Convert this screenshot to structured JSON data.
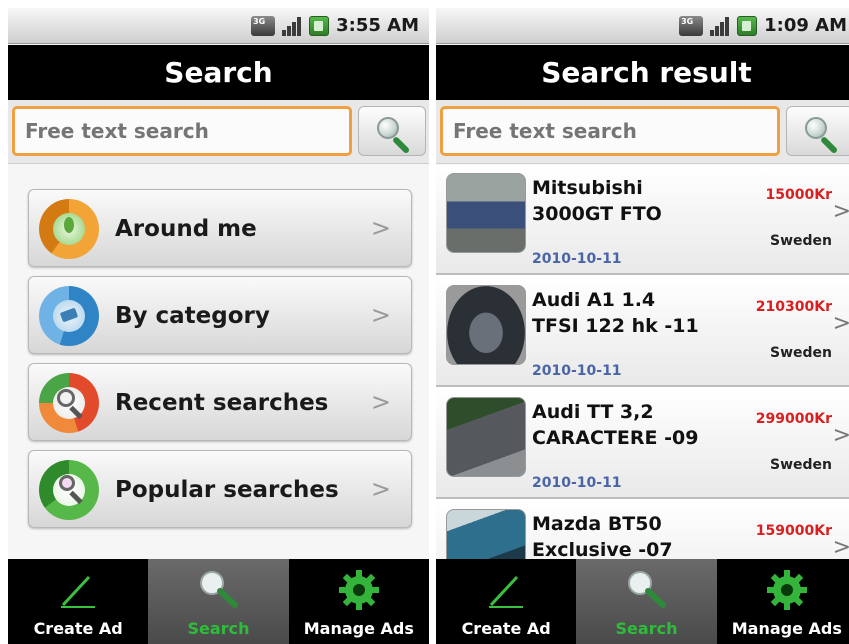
{
  "left_screen": {
    "status": {
      "time": "3:55 AM",
      "network": "3G"
    },
    "title": "Search",
    "search": {
      "placeholder": "Free text search"
    },
    "menu": [
      {
        "label": "Around me",
        "icon": "location-icon"
      },
      {
        "label": "By category",
        "icon": "category-icon"
      },
      {
        "label": "Recent searches",
        "icon": "recent-search-icon"
      },
      {
        "label": "Popular searches",
        "icon": "popular-search-icon"
      }
    ],
    "chevron": ">"
  },
  "right_screen": {
    "status": {
      "time": "1:09 AM",
      "network": "3G"
    },
    "title": "Search result",
    "search": {
      "placeholder": "Free text search"
    },
    "results": [
      {
        "title": "Mitsubishi 3000GT FTO",
        "price": "15000Kr",
        "country": "Sweden",
        "date": "2010-10-11",
        "thumb_color": "#3a4f7a"
      },
      {
        "title": "Audi A1 1.4 TFSI 122 hk -11",
        "price": "210300Kr",
        "country": "Sweden",
        "date": "2010-10-11",
        "thumb_color": "#2b2f36"
      },
      {
        "title": "Audi TT 3,2 CARACTERE -09",
        "price": "299000Kr",
        "country": "Sweden",
        "date": "2010-10-11",
        "thumb_color": "#55595e"
      },
      {
        "title": "Mazda BT50 Exclusive -07",
        "price": "159000Kr",
        "country": "",
        "date": "",
        "thumb_color": "#2d6f8c"
      }
    ],
    "chevron": ">"
  },
  "bottom_nav": [
    {
      "label": "Create Ad",
      "icon": "pencil-icon",
      "active": false
    },
    {
      "label": "Search",
      "icon": "search-icon",
      "active": true
    },
    {
      "label": "Manage Ads",
      "icon": "gear-icon",
      "active": false
    }
  ],
  "colors": {
    "accent_green": "#2ebd3a",
    "price_red": "#d91f1f",
    "date_blue": "#4a64a8",
    "search_border": "#f0a040"
  }
}
